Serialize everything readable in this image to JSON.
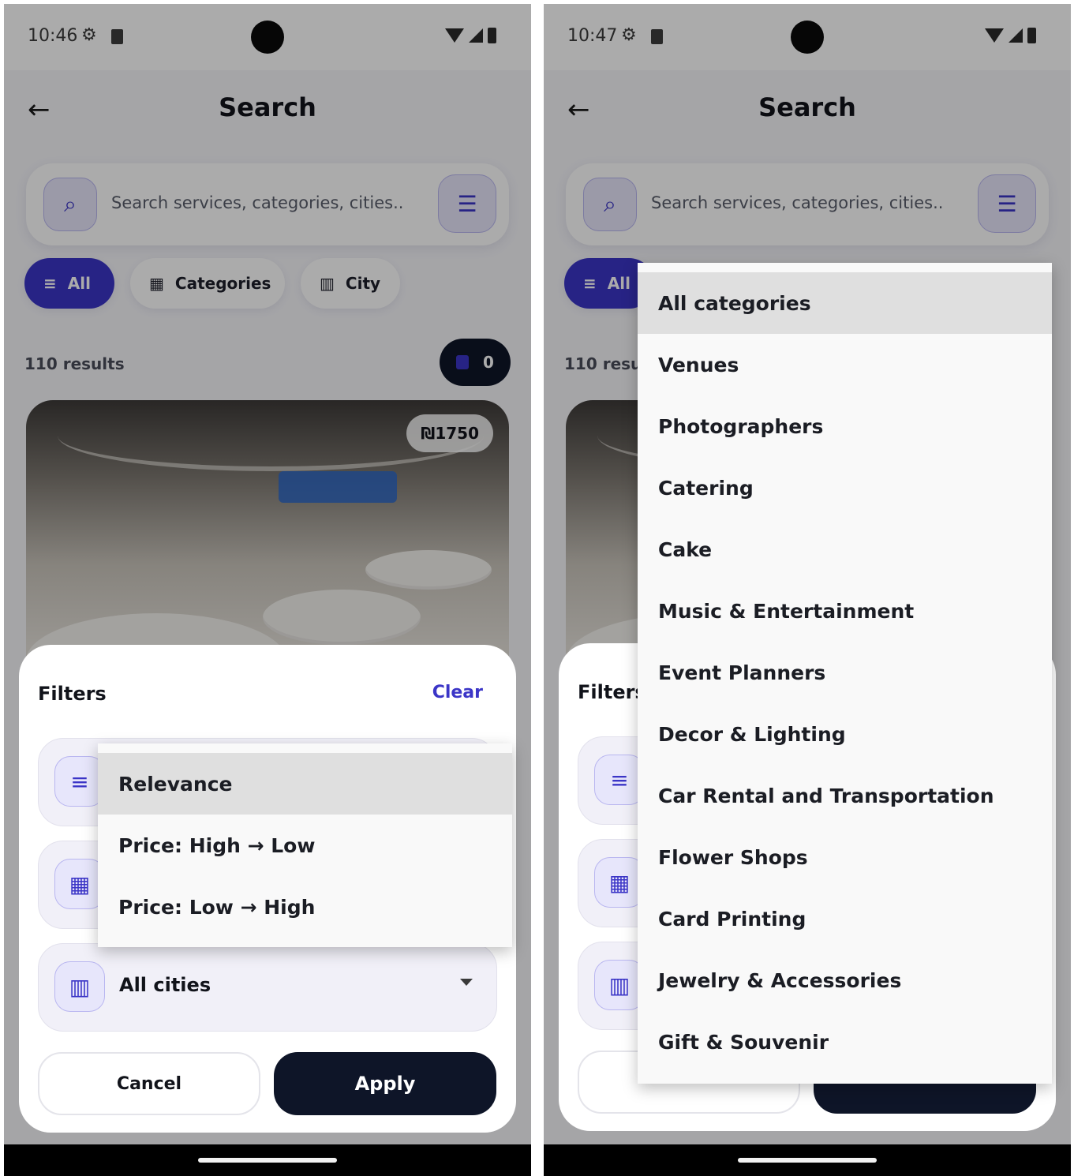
{
  "screens": [
    {
      "status_time": "10:46",
      "title": "Search",
      "search_placeholder": "Search services, categories, cities..",
      "chips": {
        "all": "All",
        "categories": "Categories",
        "city": "City"
      },
      "results_count": "110 results",
      "cart_count": "0",
      "listing_price": "₪1750",
      "sheet": {
        "title": "Filters",
        "clear": "Clear",
        "city_value": "All cities",
        "cancel": "Cancel",
        "apply": "Apply"
      },
      "sort_options": [
        "Relevance",
        "Price: High → Low",
        "Price: Low → High"
      ],
      "sort_selected_index": 0
    },
    {
      "status_time": "10:47",
      "title": "Search",
      "search_placeholder": "Search services, categories, cities..",
      "chips": {
        "all": "All"
      },
      "results_count": "110 results",
      "sheet": {
        "title": "Filters"
      },
      "category_options": [
        "All categories",
        "Venues",
        "Photographers",
        "Catering",
        "Cake",
        "Music & Entertainment",
        "Event Planners",
        "Decor & Lighting",
        "Car Rental and Transportation",
        "Flower Shops",
        "Card Printing",
        "Jewelry & Accessories",
        "Gift & Souvenir"
      ],
      "category_selected_index": 0
    }
  ],
  "colors": {
    "accent": "#3b35c7",
    "dark": "#0e1528"
  }
}
